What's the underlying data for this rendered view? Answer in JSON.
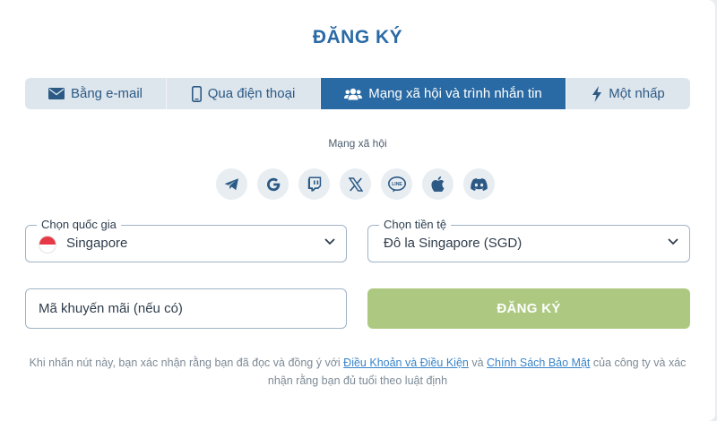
{
  "title": "ĐĂNG KÝ",
  "tabs": [
    {
      "label": "Bằng e-mail",
      "icon": "envelope-icon"
    },
    {
      "label": "Qua điện thoại",
      "icon": "phone-icon"
    },
    {
      "label": "Mạng xã hội và trình nhắn tin",
      "icon": "users-icon",
      "active": true
    },
    {
      "label": "Một nhấp",
      "icon": "lightning-icon"
    }
  ],
  "social": {
    "label": "Mạng xã hội",
    "providers": [
      "telegram-icon",
      "google-icon",
      "twitch-icon",
      "x-icon",
      "line-icon",
      "apple-icon",
      "discord-icon"
    ],
    "line_text": "LINE"
  },
  "country": {
    "legend": "Chọn quốc gia",
    "value": "Singapore"
  },
  "currency": {
    "legend": "Chọn tiền tệ",
    "value": "Đô la Singapore (SGD)"
  },
  "promo": {
    "placeholder": "Mã khuyến mãi (nếu có)"
  },
  "submit_label": "ĐĂNG KÝ",
  "terms": {
    "prefix": "Khi nhấn nút này, bạn xác nhận rằng bạn đã đọc và đồng ý với",
    "terms_link": "Điều Khoản và Điều Kiện",
    "and": "và",
    "privacy_link": "Chính Sách Bảo Mật",
    "suffix": "của công ty và xác nhận rằng bạn đủ tuổi theo luật định"
  },
  "colors": {
    "accent": "#2a6aa4",
    "tab_bg": "#dde5ed",
    "submit_bg": "#adc981",
    "link": "#3a84c9"
  }
}
